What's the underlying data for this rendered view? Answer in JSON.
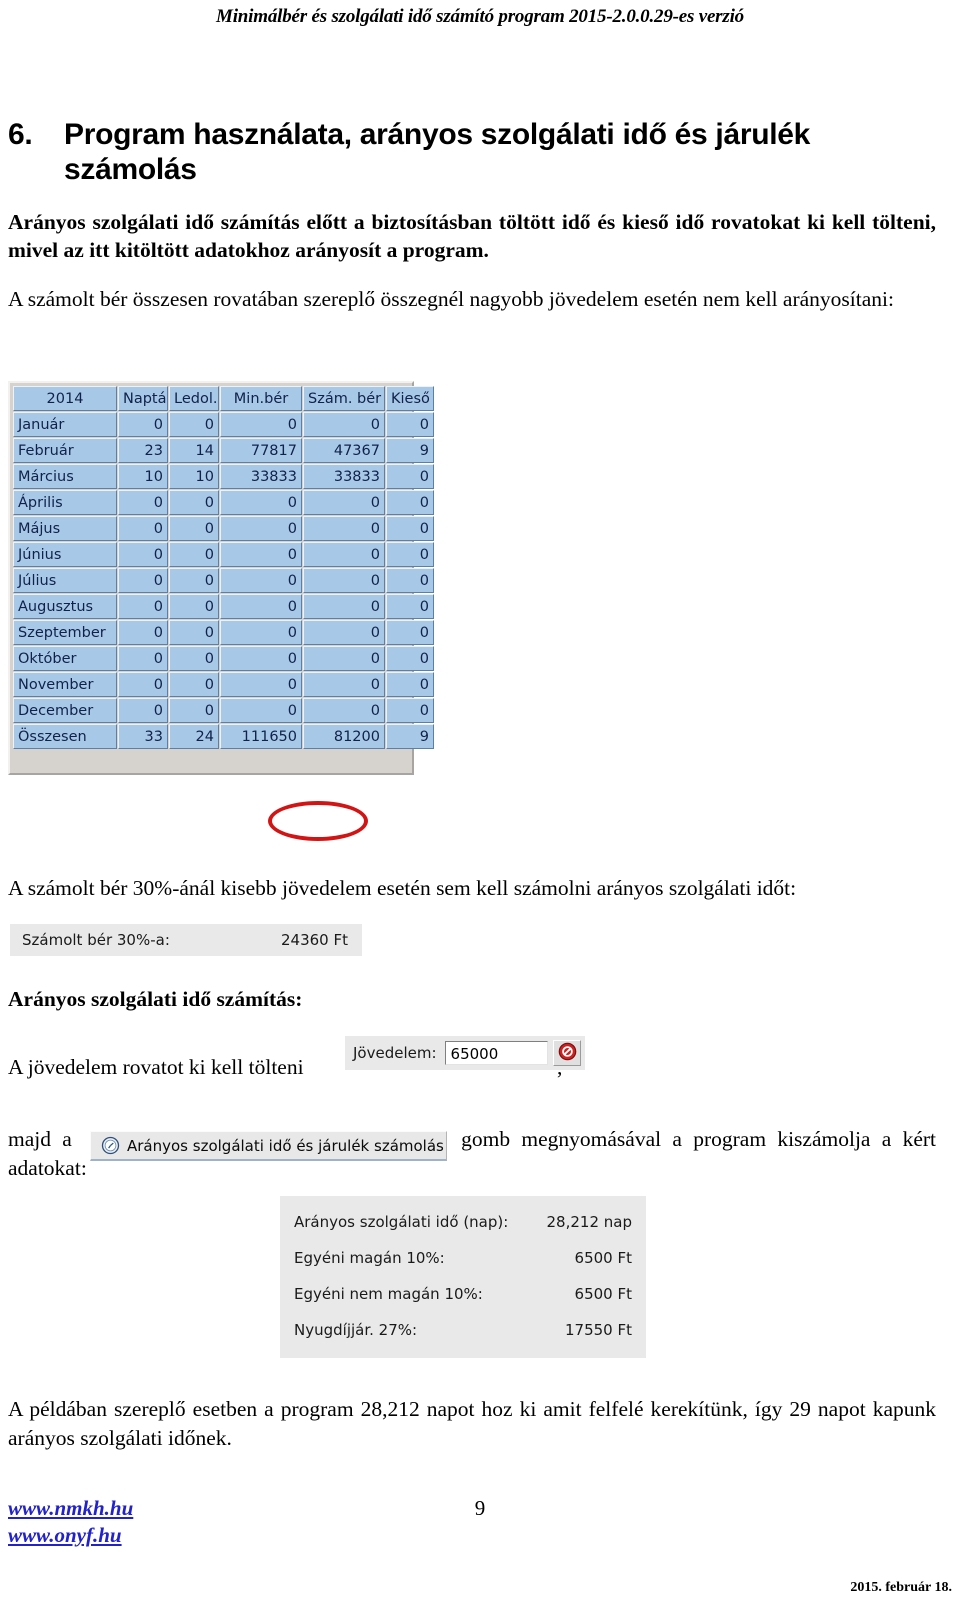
{
  "document": {
    "running_header": "Minimálbér és szolgálati idő számító program 2015-2.0.0.29-es verzió",
    "section_number": "6.",
    "section_title": "Program használata, arányos szolgálati idő és járulék számolás",
    "para_1": "Arányos szolgálati idő számítás előtt a biztosításban töltött idő és kieső idő rovatokat ki kell tölteni, mivel az itt kitöltött adatokhoz arányosít a program.",
    "para_2": "A számolt bér összesen rovatában szereplő összegnél nagyobb jövedelem esetén nem kell arányosítani:",
    "para_3": "A számolt bér 30%-ánál kisebb jövedelem esetén sem kell számolni arányos szolgálati időt:",
    "sub_head": "Arányos szolgálati idő számítás:",
    "para_4_before": "A jövedelem rovatot ki kell tölteni",
    "para_4_after": ",",
    "para_5_before": "majd a",
    "para_5_after": "gomb megnyomásával a program kiszámolja a kért adatokat:",
    "para_6": "A példában szereplő esetben a program 28,212 napot hoz ki amit felfelé kerekítünk, így 29 napot kapunk arányos szolgálati időnek.",
    "footer": {
      "link_1": "www.nmkh.hu",
      "link_2": "www.onyf.hu",
      "page_number": "9",
      "date": "2015. február 18."
    }
  },
  "month_grid": {
    "columns": [
      "2014",
      "Naptá",
      "Ledol.",
      "Min.bér",
      "Szám. bér",
      "Kieső"
    ],
    "rows": [
      {
        "month": "Január",
        "naptari": "0",
        "ledolgozott": "0",
        "minber": "0",
        "szamber": "0",
        "kieso": "0"
      },
      {
        "month": "Február",
        "naptari": "23",
        "ledolgozott": "14",
        "minber": "77817",
        "szamber": "47367",
        "kieso": "9"
      },
      {
        "month": "Március",
        "naptari": "10",
        "ledolgozott": "10",
        "minber": "33833",
        "szamber": "33833",
        "kieso": "0"
      },
      {
        "month": "Április",
        "naptari": "0",
        "ledolgozott": "0",
        "minber": "0",
        "szamber": "0",
        "kieso": "0"
      },
      {
        "month": "Május",
        "naptari": "0",
        "ledolgozott": "0",
        "minber": "0",
        "szamber": "0",
        "kieso": "0"
      },
      {
        "month": "Június",
        "naptari": "0",
        "ledolgozott": "0",
        "minber": "0",
        "szamber": "0",
        "kieso": "0"
      },
      {
        "month": "Július",
        "naptari": "0",
        "ledolgozott": "0",
        "minber": "0",
        "szamber": "0",
        "kieso": "0"
      },
      {
        "month": "Augusztus",
        "naptari": "0",
        "ledolgozott": "0",
        "minber": "0",
        "szamber": "0",
        "kieso": "0"
      },
      {
        "month": "Szeptember",
        "naptari": "0",
        "ledolgozott": "0",
        "minber": "0",
        "szamber": "0",
        "kieso": "0"
      },
      {
        "month": "Október",
        "naptari": "0",
        "ledolgozott": "0",
        "minber": "0",
        "szamber": "0",
        "kieso": "0"
      },
      {
        "month": "November",
        "naptari": "0",
        "ledolgozott": "0",
        "minber": "0",
        "szamber": "0",
        "kieso": "0"
      },
      {
        "month": "December",
        "naptari": "0",
        "ledolgozott": "0",
        "minber": "0",
        "szamber": "0",
        "kieso": "0"
      }
    ],
    "total_row": {
      "month": "Összesen",
      "naptari": "33",
      "ledolgozott": "24",
      "minber": "111650",
      "szamber": "81200",
      "kieso": "9"
    },
    "highlight_color": "#d21414",
    "highlighted_value": "81200",
    "row_background": "#a8c8e8"
  },
  "panel_30pct": {
    "label": "Számolt bér 30%-a:",
    "value": "24360 Ft"
  },
  "income_widget": {
    "label": "Jövedelem:",
    "value": "65000",
    "clear_icon": "no-entry-icon",
    "clear_icon_color": "#cc2222"
  },
  "calc_button": {
    "label": "Arányos szolgálati idő és járulék számolás",
    "icon": "clock-icon"
  },
  "results_panel": {
    "rows": [
      {
        "label": "Arányos szolgálati idő (nap):",
        "value": "28,212 nap"
      },
      {
        "label": "Egyéni magán 10%:",
        "value": "6500 Ft"
      },
      {
        "label": "Egyéni nem magán 10%:",
        "value": "6500 Ft"
      },
      {
        "label": "Nyugdíjjár. 27%:",
        "value": "17550 Ft"
      }
    ]
  }
}
